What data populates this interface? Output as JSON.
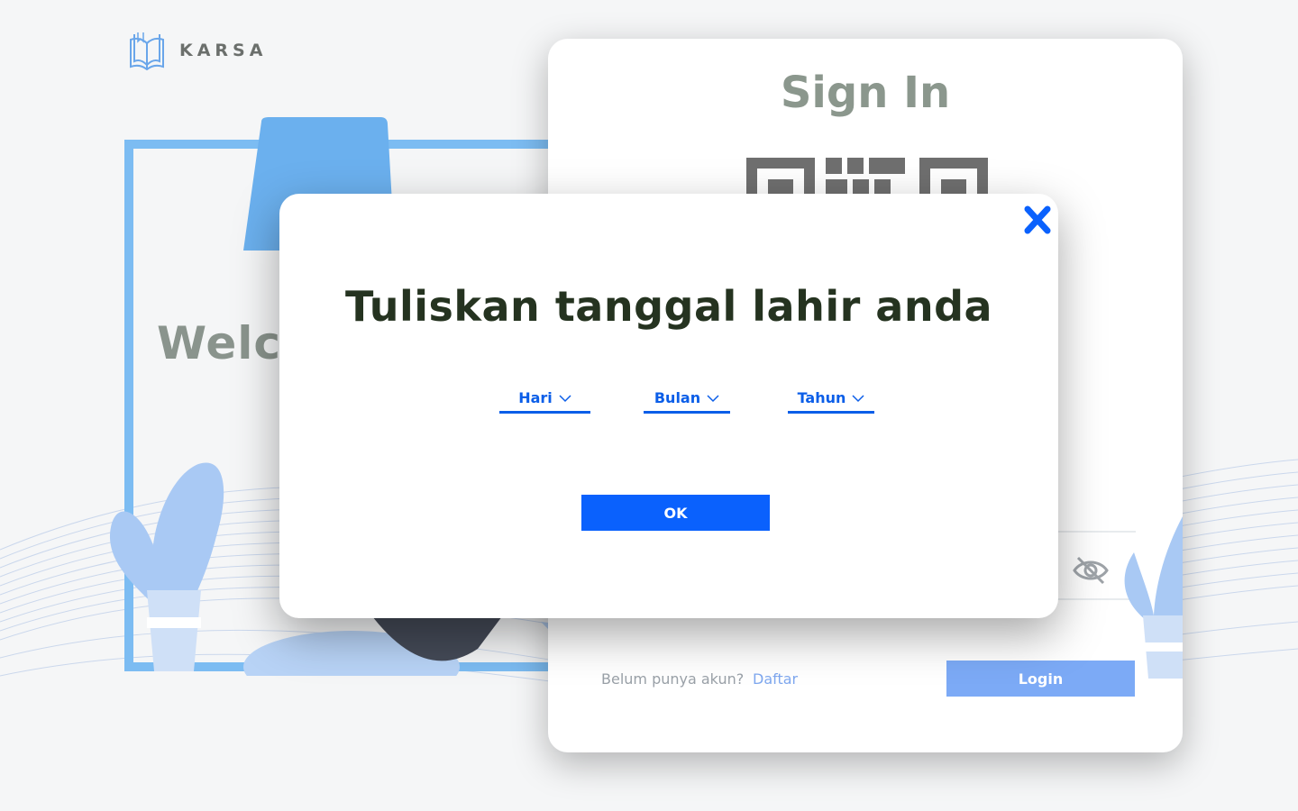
{
  "app": {
    "logo_text": "KARSA"
  },
  "welcome": {
    "title_visible": "Welco"
  },
  "signin": {
    "title": "Sign In",
    "signup_prompt": "Belum punya akun?",
    "signup_link": "Daftar",
    "login_label": "Login"
  },
  "modal": {
    "title": "Tuliskan tanggal lahir anda",
    "day_select": "Hari",
    "month_select": "Bulan",
    "year_select": "Tahun",
    "ok_label": "OK"
  },
  "colors": {
    "accent": "#0a61fd",
    "select_text": "#0b5ee8",
    "modal_title": "#253320",
    "frame": "#7cbcf2",
    "login_button": "#7caaf6"
  },
  "icons": [
    "book-logo-icon",
    "close-icon",
    "chevron-down-icon",
    "eye-off-icon",
    "qr-code-icon"
  ]
}
